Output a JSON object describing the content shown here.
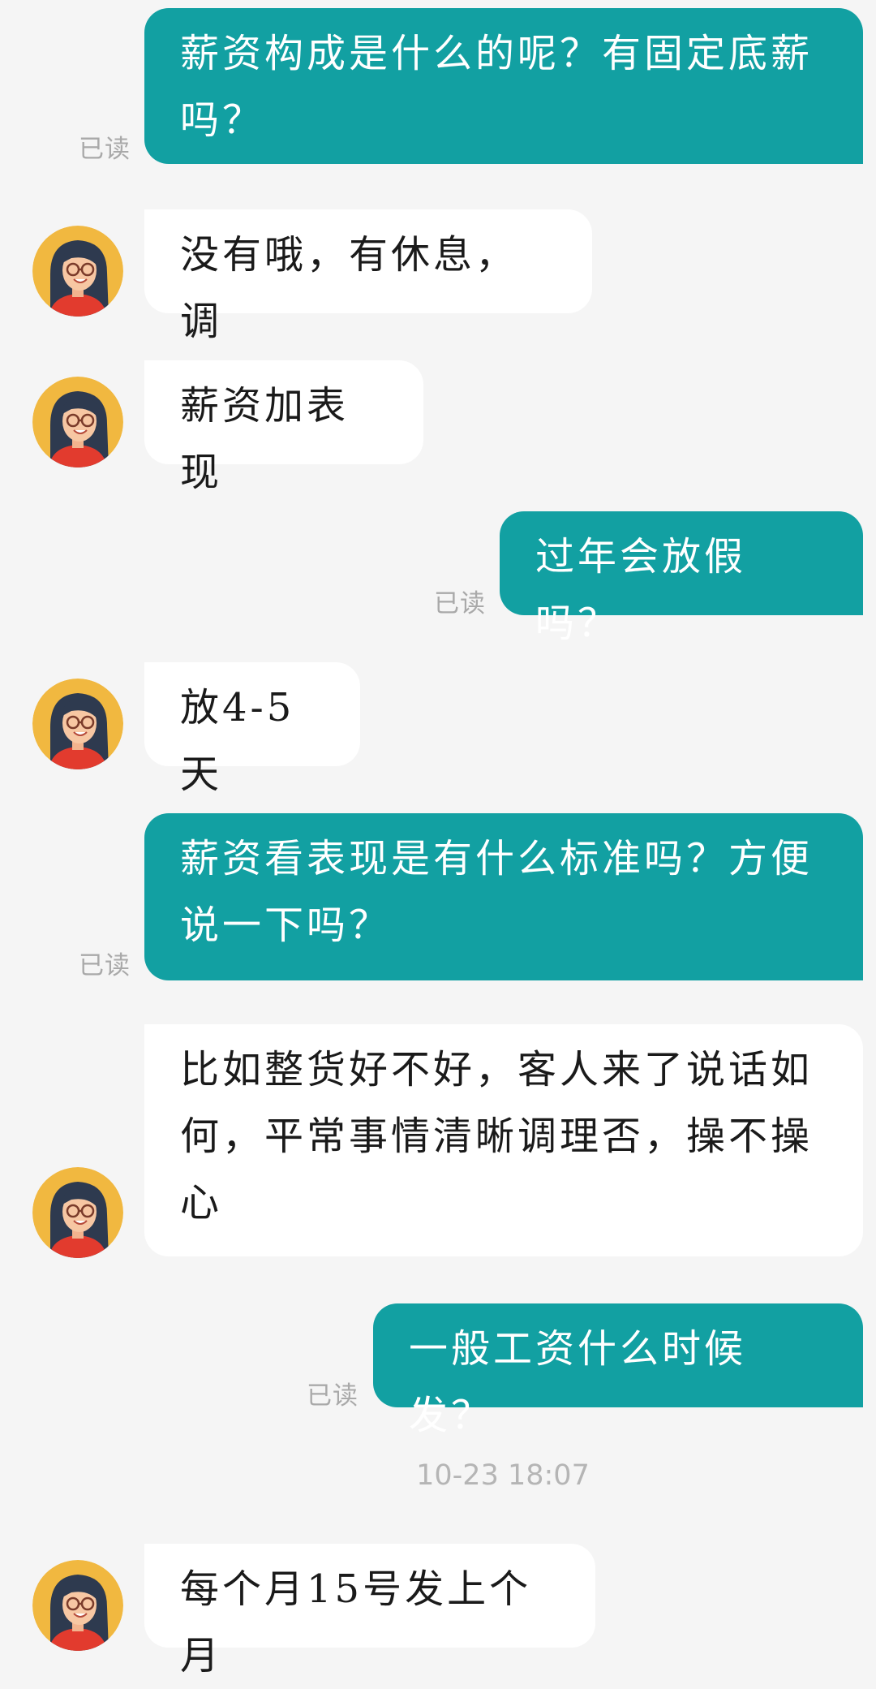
{
  "chat": {
    "status_read": "已读",
    "timestamp": "10-23 18:07",
    "messages": [
      {
        "side": "out",
        "text": "薪资构成是什么的呢？有固定底薪\n吗？",
        "read": "已读"
      },
      {
        "side": "in",
        "text": "没有哦，有休息，调"
      },
      {
        "side": "in",
        "text": "薪资加表现"
      },
      {
        "side": "out",
        "text": "过年会放假吗？",
        "read": "已读"
      },
      {
        "side": "in",
        "text": "放4-5天"
      },
      {
        "side": "out",
        "text": "薪资看表现是有什么标准吗？方便\n说一下吗？",
        "read": "已读"
      },
      {
        "side": "in",
        "text": "比如整货好不好，客人来了说话如\n何，平常事情清晰调理否，操不操\n心"
      },
      {
        "side": "out",
        "text": "一般工资什么时候发？",
        "read": "已读"
      },
      {
        "side": "in",
        "text": "每个月15号发上个月"
      }
    ],
    "colors": {
      "outgoing_bubble": "#12a0a2",
      "incoming_bubble": "#ffffff",
      "background": "#f5f5f5",
      "read_label": "#a9a9a9"
    },
    "avatar_icon": "woman-with-glasses-avatar-icon"
  }
}
